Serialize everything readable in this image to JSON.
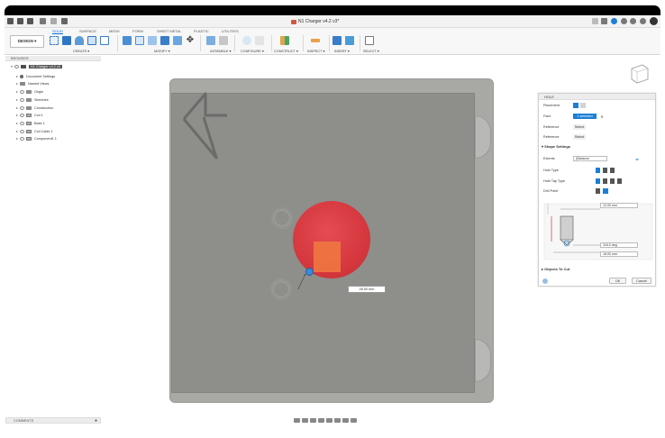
{
  "window": {
    "title": "N1 Charger v4.2 v3*"
  },
  "ribbon": {
    "workspace_button": "DESIGN ▾",
    "tabs": [
      "SOLID",
      "SURFACE",
      "MESH",
      "FORM",
      "SHEET METAL",
      "PLASTIC",
      "UTILITIES"
    ],
    "groups": [
      "CREATE ▾",
      "MODIFY ▾",
      "ASSEMBLE ▾",
      "CONFIGURE ▾",
      "CONSTRUCT ▾",
      "INSPECT ▾",
      "INSERT ▾",
      "SELECT ▾"
    ]
  },
  "browser": {
    "title": "BROWSER",
    "items": [
      {
        "label": "N1 Charger v4.2 v3",
        "selected": true
      },
      {
        "label": "Document Settings"
      },
      {
        "label": "Named Views"
      },
      {
        "label": "Origin"
      },
      {
        "label": "Sketches"
      },
      {
        "label": "Construction"
      },
      {
        "label": "Coil 1"
      },
      {
        "label": "Base 1"
      },
      {
        "label": "Coil Cable 1"
      },
      {
        "label": "Component1 1"
      }
    ]
  },
  "comments": {
    "label": "COMMENTS"
  },
  "viewport": {
    "dimension_value": "28.00 mm"
  },
  "hole_panel": {
    "title": "HOLE",
    "placement_label": "Placement",
    "face_label": "Face",
    "face_value": "1 selected",
    "reference1_label": "Reference",
    "reference1_value": "Select",
    "reference2_label": "Reference",
    "reference2_value": "Select",
    "shape_settings": "Shape Settings",
    "extents_label": "Extents",
    "extents_value": "Distance",
    "hole_type_label": "Hole Type",
    "hole_tap_type_label": "Hole Tap Type",
    "drill_point_label": "Drill Point",
    "diameter": "12.00 mm",
    "angle": "118.0 deg",
    "depth": "18.00 mm",
    "objects_to_cut": "Objects To Cut",
    "ok": "OK",
    "cancel": "Cancel"
  },
  "colors": {
    "accent": "#0a6ed1",
    "selection_red": "#d9333a",
    "plate": "#8e8e8b"
  }
}
